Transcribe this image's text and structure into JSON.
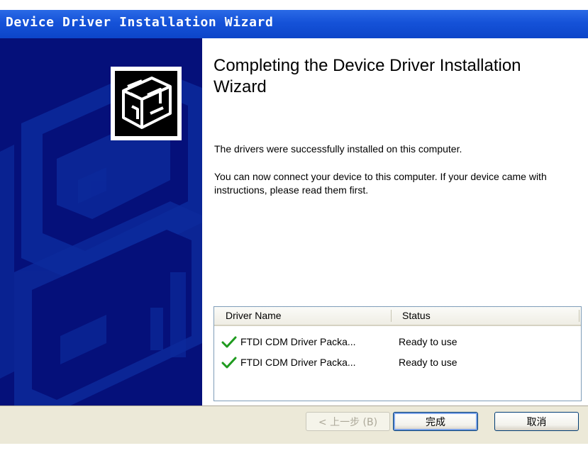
{
  "window": {
    "title": "Device Driver Installation Wizard"
  },
  "heading": "Completing the Device Driver Installation Wizard",
  "messages": {
    "success": "The drivers were successfully installed on this computer.",
    "connect": "You can now connect your device to this computer. If your device came with instructions, please read them first."
  },
  "driver_list": {
    "columns": {
      "name": "Driver Name",
      "status": "Status"
    },
    "rows": [
      {
        "name": "FTDI CDM Driver Packa...",
        "status": "Ready to use",
        "icon": "check-icon"
      },
      {
        "name": "FTDI CDM Driver Packa...",
        "status": "Ready to use",
        "icon": "check-icon"
      }
    ]
  },
  "buttons": {
    "back": "< 上一步 (B)",
    "finish": "完成",
    "cancel": "取消"
  },
  "colors": {
    "titlebar": "#0c45c9",
    "left_panel": "#05107a",
    "footer": "#ece9d8",
    "check": "#1f9b1f"
  }
}
